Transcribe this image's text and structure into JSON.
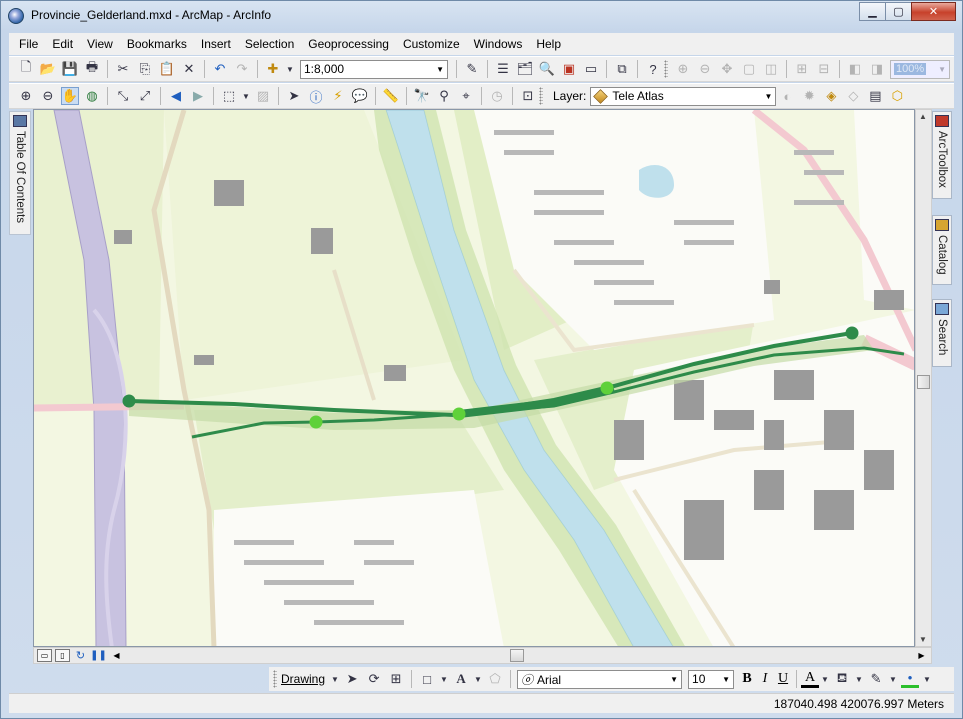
{
  "window": {
    "title": "Provincie_Gelderland.mxd - ArcMap - ArcInfo",
    "minimize": "▁",
    "maximize": "▢",
    "close": "✕"
  },
  "menu": [
    {
      "label": "File"
    },
    {
      "label": "Edit"
    },
    {
      "label": "View"
    },
    {
      "label": "Bookmarks"
    },
    {
      "label": "Insert"
    },
    {
      "label": "Selection"
    },
    {
      "label": "Geoprocessing"
    },
    {
      "label": "Customize"
    },
    {
      "label": "Windows"
    },
    {
      "label": "Help"
    }
  ],
  "toolbar": {
    "scale": "1:8,000",
    "layer_label": "Layer:",
    "layer_value": "Tele Atlas",
    "zoom_percent": "100%"
  },
  "dock": {
    "toc": "Table Of Contents",
    "arctoolbox": "ArcToolbox",
    "catalog": "Catalog",
    "search": "Search"
  },
  "drawbar": {
    "drawing_label": "Drawing",
    "font": "Arial",
    "size": "10",
    "bold": "B",
    "italic": "I",
    "underline": "U",
    "font_color": "A"
  },
  "status": {
    "coordinates": "187040.498  420076.997 Meters"
  },
  "colors": {
    "route_dark": "#2e8b4a",
    "route_point_light": "#5fd13a",
    "water": "#bfe0ec",
    "land": "#f3f7e2",
    "green_area": "#dfeec2",
    "building": "#9a9a9a"
  }
}
